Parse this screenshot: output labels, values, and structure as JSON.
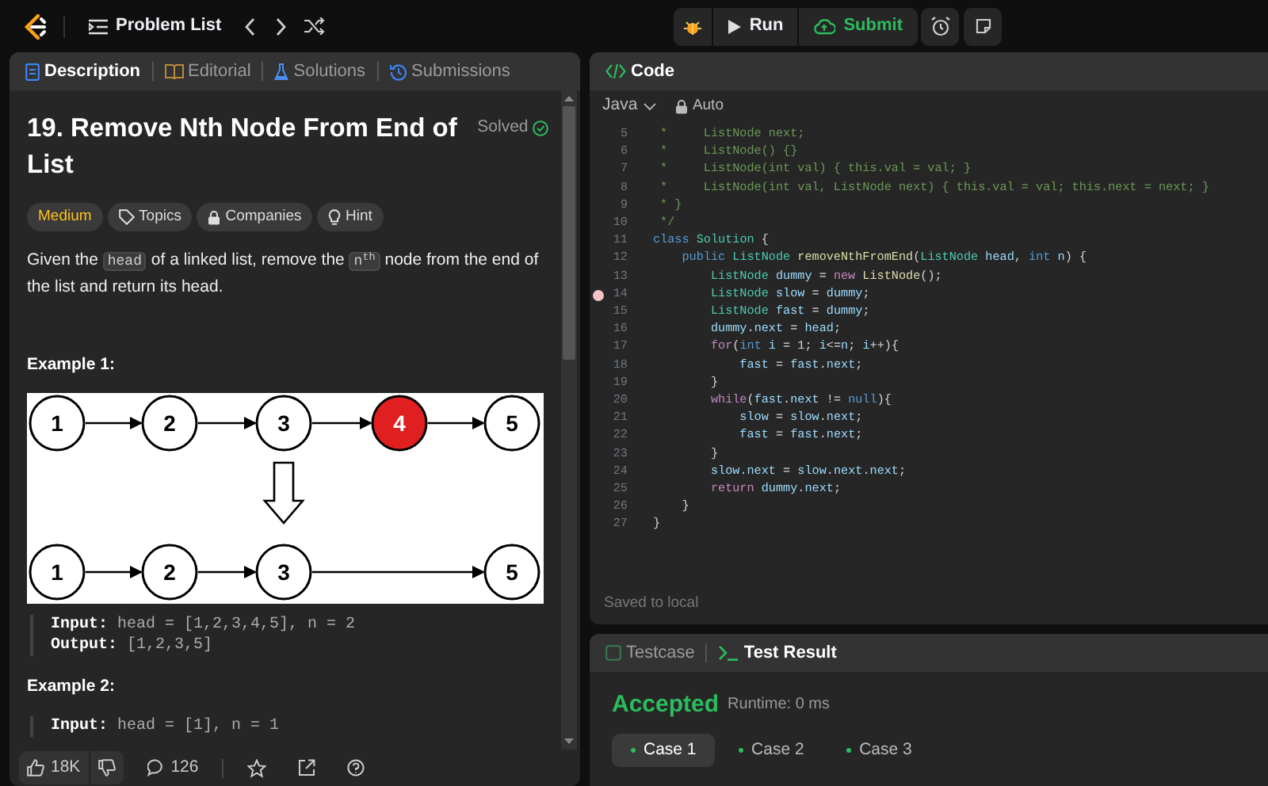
{
  "topbar": {
    "problem_list": "Problem List",
    "run": "Run",
    "submit": "Submit"
  },
  "left_tabs": [
    {
      "label": "Description",
      "selected": true
    },
    {
      "label": "Editorial",
      "selected": false
    },
    {
      "label": "Solutions",
      "selected": false
    },
    {
      "label": "Submissions",
      "selected": false
    }
  ],
  "problem": {
    "title": "19. Remove Nth Node From End of List",
    "status": "Solved",
    "tags": [
      {
        "label": "Medium",
        "kind": "difficulty"
      },
      {
        "label": "Topics",
        "kind": "topics"
      },
      {
        "label": "Companies",
        "kind": "companies"
      },
      {
        "label": "Hint",
        "kind": "hint"
      }
    ],
    "description": [
      {
        "kind": "text",
        "text": "Given the "
      },
      {
        "kind": "code",
        "text": "head"
      },
      {
        "kind": "text",
        "text": " of a linked list, remove the "
      },
      {
        "kind": "code",
        "text": "n$^{th}$"
      },
      {
        "kind": "text",
        "text": " node from the end of the list and return its head."
      }
    ],
    "examples": [
      {
        "title": "Example 1:",
        "diagram": {
          "before": [
            {
              "label": "1",
              "highlighted": false
            },
            {
              "label": "2",
              "highlighted": false
            },
            {
              "label": "3",
              "highlighted": false
            },
            {
              "label": "4",
              "highlighted": true
            },
            {
              "label": "5",
              "highlighted": false
            }
          ],
          "after": [
            "1",
            "2",
            "3",
            "5"
          ]
        },
        "lines": [
          "**Input:** head = [1,2,3,4,5], n = 2",
          "**Output:** [1,2,3,5]"
        ]
      },
      {
        "title": "Example 2:",
        "lines": [
          "**Input:** head = [1], n = 1"
        ]
      }
    ]
  },
  "footer": {
    "likes": "18K",
    "comments": "126"
  },
  "code_panel": {
    "title": "Code",
    "language": "Java",
    "mode": "Auto",
    "saved": "Saved to local",
    "lines": [
      {
        "number": "5",
        "breakpoint": false,
        "tokens": [
          {
            "kind": "comment",
            "text": " *     ListNode next;"
          }
        ]
      },
      {
        "number": "6",
        "breakpoint": false,
        "tokens": [
          {
            "kind": "comment",
            "text": " *     ListNode() {}"
          }
        ]
      },
      {
        "number": "7",
        "breakpoint": false,
        "tokens": [
          {
            "kind": "comment",
            "text": " *     ListNode(int val) { this.val = val; }"
          }
        ]
      },
      {
        "number": "8",
        "breakpoint": false,
        "tokens": [
          {
            "kind": "comment",
            "text": " *     ListNode(int val, ListNode next) { this.val = val; this.next = next; }"
          }
        ]
      },
      {
        "number": "9",
        "breakpoint": false,
        "tokens": [
          {
            "kind": "comment",
            "text": " * }"
          }
        ]
      },
      {
        "number": "10",
        "breakpoint": false,
        "tokens": [
          {
            "kind": "comment",
            "text": " */"
          }
        ]
      },
      {
        "number": "11",
        "breakpoint": false,
        "tokens": [
          {
            "kind": "keyword",
            "text": "class"
          },
          {
            "kind": "type",
            "text": " Solution"
          },
          {
            "kind": "plain",
            "text": " {"
          }
        ]
      },
      {
        "number": "12",
        "breakpoint": false,
        "tokens": [
          {
            "kind": "keyword",
            "text": "    public"
          },
          {
            "kind": "type",
            "text": " ListNode"
          },
          {
            "kind": "func",
            "text": " removeNthFromEnd"
          },
          {
            "kind": "plain",
            "text": "("
          },
          {
            "kind": "type",
            "text": "ListNode"
          },
          {
            "kind": "var",
            "text": " head"
          },
          {
            "kind": "plain",
            "text": ","
          },
          {
            "kind": "keyword",
            "text": " int"
          },
          {
            "kind": "var",
            "text": " n"
          },
          {
            "kind": "plain",
            "text": ") {"
          }
        ]
      },
      {
        "number": "13",
        "breakpoint": false,
        "tokens": [
          {
            "kind": "type",
            "text": "        ListNode"
          },
          {
            "kind": "var",
            "text": " dummy"
          },
          {
            "kind": "plain",
            "text": " ="
          },
          {
            "kind": "control",
            "text": " new"
          },
          {
            "kind": "func",
            "text": " ListNode"
          },
          {
            "kind": "plain",
            "text": "();"
          }
        ]
      },
      {
        "number": "14",
        "breakpoint": true,
        "tokens": [
          {
            "kind": "type",
            "text": "        ListNode"
          },
          {
            "kind": "var",
            "text": " slow"
          },
          {
            "kind": "plain",
            "text": " ="
          },
          {
            "kind": "var",
            "text": " dummy"
          },
          {
            "kind": "plain",
            "text": ";"
          }
        ]
      },
      {
        "number": "15",
        "breakpoint": false,
        "tokens": [
          {
            "kind": "type",
            "text": "        ListNode"
          },
          {
            "kind": "var",
            "text": " fast"
          },
          {
            "kind": "plain",
            "text": " ="
          },
          {
            "kind": "var",
            "text": " dummy"
          },
          {
            "kind": "plain",
            "text": ";"
          }
        ]
      },
      {
        "number": "16",
        "breakpoint": false,
        "tokens": [
          {
            "kind": "var",
            "text": "        dummy"
          },
          {
            "kind": "plain",
            "text": "."
          },
          {
            "kind": "var",
            "text": "next"
          },
          {
            "kind": "plain",
            "text": " ="
          },
          {
            "kind": "var",
            "text": " head"
          },
          {
            "kind": "plain",
            "text": ";"
          }
        ]
      },
      {
        "number": "17",
        "breakpoint": false,
        "tokens": [
          {
            "kind": "control",
            "text": "        for"
          },
          {
            "kind": "plain",
            "text": "("
          },
          {
            "kind": "keyword",
            "text": "int"
          },
          {
            "kind": "var",
            "text": " i"
          },
          {
            "kind": "plain",
            "text": " = 1;"
          },
          {
            "kind": "var",
            "text": " i"
          },
          {
            "kind": "plain",
            "text": "<="
          },
          {
            "kind": "var",
            "text": "n"
          },
          {
            "kind": "plain",
            "text": ";"
          },
          {
            "kind": "var",
            "text": " i"
          },
          {
            "kind": "plain",
            "text": "++){"
          }
        ]
      },
      {
        "number": "18",
        "breakpoint": false,
        "tokens": [
          {
            "kind": "var",
            "text": "            fast"
          },
          {
            "kind": "plain",
            "text": " ="
          },
          {
            "kind": "var",
            "text": " fast"
          },
          {
            "kind": "plain",
            "text": "."
          },
          {
            "kind": "var",
            "text": "next"
          },
          {
            "kind": "plain",
            "text": ";"
          }
        ]
      },
      {
        "number": "19",
        "breakpoint": false,
        "tokens": [
          {
            "kind": "plain",
            "text": "        }"
          }
        ]
      },
      {
        "number": "20",
        "breakpoint": false,
        "tokens": [
          {
            "kind": "control",
            "text": "        while"
          },
          {
            "kind": "plain",
            "text": "("
          },
          {
            "kind": "var",
            "text": "fast"
          },
          {
            "kind": "plain",
            "text": "."
          },
          {
            "kind": "var",
            "text": "next"
          },
          {
            "kind": "plain",
            "text": " !="
          },
          {
            "kind": "keyword",
            "text": " null"
          },
          {
            "kind": "plain",
            "text": "){"
          }
        ]
      },
      {
        "number": "21",
        "breakpoint": false,
        "tokens": [
          {
            "kind": "var",
            "text": "            slow"
          },
          {
            "kind": "plain",
            "text": " ="
          },
          {
            "kind": "var",
            "text": " slow"
          },
          {
            "kind": "plain",
            "text": "."
          },
          {
            "kind": "var",
            "text": "next"
          },
          {
            "kind": "plain",
            "text": ";"
          }
        ]
      },
      {
        "number": "22",
        "breakpoint": false,
        "tokens": [
          {
            "kind": "var",
            "text": "            fast"
          },
          {
            "kind": "plain",
            "text": " ="
          },
          {
            "kind": "var",
            "text": " fast"
          },
          {
            "kind": "plain",
            "text": "."
          },
          {
            "kind": "var",
            "text": "next"
          },
          {
            "kind": "plain",
            "text": ";"
          }
        ]
      },
      {
        "number": "23",
        "breakpoint": false,
        "tokens": [
          {
            "kind": "plain",
            "text": "        }"
          }
        ]
      },
      {
        "number": "24",
        "breakpoint": false,
        "tokens": [
          {
            "kind": "var",
            "text": "        slow"
          },
          {
            "kind": "plain",
            "text": "."
          },
          {
            "kind": "var",
            "text": "next"
          },
          {
            "kind": "plain",
            "text": " ="
          },
          {
            "kind": "var",
            "text": " slow"
          },
          {
            "kind": "plain",
            "text": "."
          },
          {
            "kind": "var",
            "text": "next"
          },
          {
            "kind": "plain",
            "text": "."
          },
          {
            "kind": "var",
            "text": "next"
          },
          {
            "kind": "plain",
            "text": ";"
          }
        ]
      },
      {
        "number": "25",
        "breakpoint": false,
        "tokens": [
          {
            "kind": "control",
            "text": "        return"
          },
          {
            "kind": "var",
            "text": " dummy"
          },
          {
            "kind": "plain",
            "text": "."
          },
          {
            "kind": "var",
            "text": "next"
          },
          {
            "kind": "plain",
            "text": ";"
          }
        ]
      },
      {
        "number": "26",
        "breakpoint": false,
        "tokens": [
          {
            "kind": "plain",
            "text": "    }"
          }
        ]
      },
      {
        "number": "27",
        "breakpoint": false,
        "tokens": [
          {
            "kind": "plain",
            "text": "}"
          }
        ]
      }
    ]
  },
  "test_panel": {
    "tabs": [
      {
        "label": "Testcase",
        "selected": false
      },
      {
        "label": "Test Result",
        "selected": true
      }
    ],
    "verdict": "Accepted",
    "runtime": "Runtime: 0 ms",
    "cases": [
      {
        "label": "Case 1",
        "selected": true
      },
      {
        "label": "Case 2",
        "selected": false
      },
      {
        "label": "Case 3",
        "selected": false
      }
    ]
  }
}
